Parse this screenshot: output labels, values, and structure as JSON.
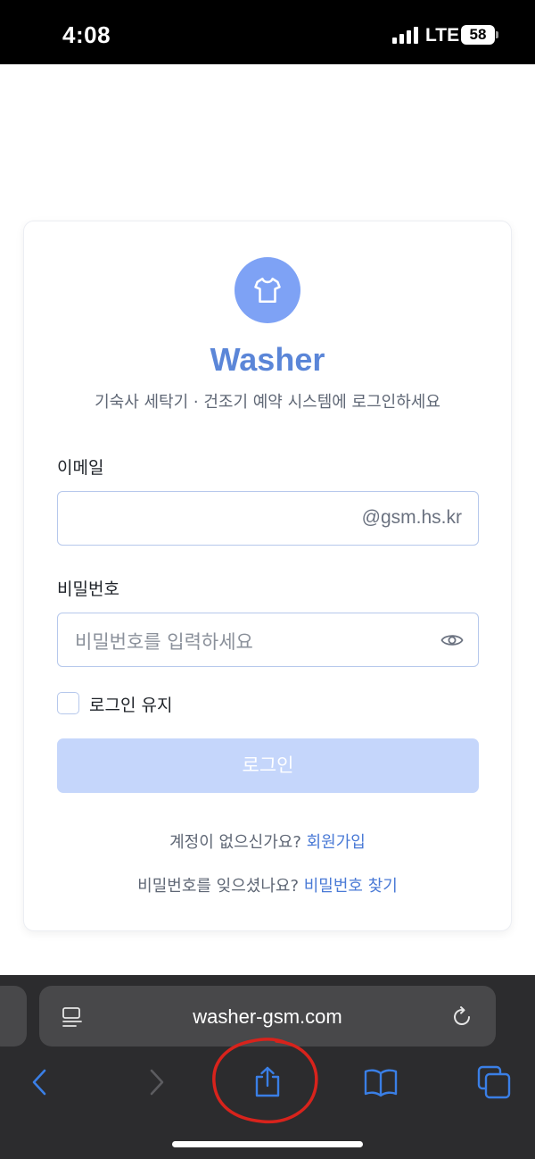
{
  "status_bar": {
    "time": "4:08",
    "network": "LTE",
    "battery": "58"
  },
  "card": {
    "brand": "Washer",
    "subtitle": "기숙사 세탁기 · 건조기 예약 시스템에 로그인하세요",
    "email": {
      "label": "이메일",
      "suffix": "@gsm.hs.kr",
      "value": ""
    },
    "password": {
      "label": "비밀번호",
      "placeholder": "비밀번호를 입력하세요"
    },
    "remember": {
      "label": "로그인 유지",
      "checked": false
    },
    "login_button": "로그인",
    "signup": {
      "prompt": "계정이 없으신가요?",
      "link": "회원가입"
    },
    "forgot": {
      "prompt": "비밀번호를 잊으셨나요?",
      "link": "비밀번호 찾기"
    }
  },
  "browser": {
    "url": "washer-gsm.com",
    "icons": [
      "reader-icon",
      "reload-icon",
      "back-icon",
      "forward-icon",
      "share-icon",
      "bookmarks-icon",
      "tabs-icon"
    ]
  },
  "colors": {
    "brand": "#5b86d8",
    "logo_bg": "#7ea2f5",
    "button_disabled": "#c5d6fb",
    "link": "#4a7ad6",
    "browser_icon": "#3a7fe6",
    "annotation": "#d8231c"
  }
}
